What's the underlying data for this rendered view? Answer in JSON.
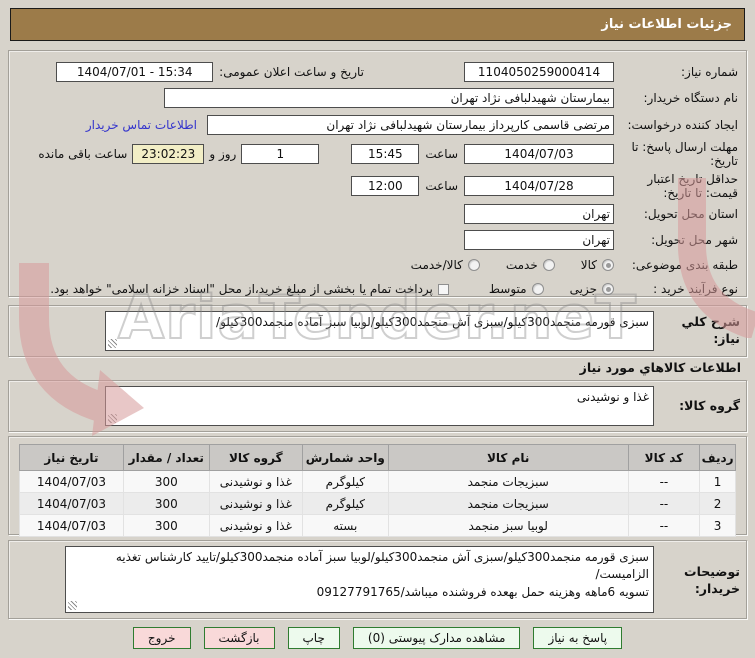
{
  "title_bar": {
    "text": "جزئیات اطلاعات نیاز"
  },
  "form": {
    "need_number": {
      "label": "شماره نیاز:",
      "value": "1104050259000414"
    },
    "announce_datetime": {
      "label": "تاریخ و ساعت اعلان عمومی:",
      "value": "1404/07/01 - 15:34"
    },
    "buyer_org": {
      "label": "نام دستگاه خریدار:",
      "value": "بیمارستان شهیدلبافی نژاد تهران"
    },
    "request_creator": {
      "label": "ایجاد کننده درخواست:",
      "value": "مرتضی  قاسمی کارپرداز بیمارستان شهیدلبافی نژاد تهران"
    },
    "buyer_contact_link": "اطلاعات تماس خریدار",
    "response_deadline": {
      "label": "مهلت ارسال پاسخ: تا تاریخ:",
      "date": "1404/07/03",
      "hour_label": "ساعت",
      "time": "15:45"
    },
    "remaining": {
      "days": "1",
      "days_label": "روز و",
      "time": "23:02:23",
      "suffix": "ساعت باقی مانده"
    },
    "price_validity": {
      "label": "حداقل تاریخ اعتبار قیمت: تا تاریخ:",
      "date": "1404/07/28",
      "hour_label": "ساعت",
      "time": "12:00"
    },
    "delivery_province": {
      "label": "استان محل تحویل:",
      "value": "تهران"
    },
    "delivery_city": {
      "label": "شهر محل تحویل:",
      "value": "تهران"
    },
    "subject_class": {
      "label": "طبقه بندی موضوعی:",
      "options": [
        "کالا",
        "خدمت",
        "کالا/خدمت"
      ],
      "selected": 0
    },
    "purchase_type": {
      "label": "نوع فرآیند خرید :",
      "options": [
        "جزیی",
        "متوسط"
      ],
      "selected": 0,
      "checkbox_label": "پرداخت تمام یا بخشی از مبلغ خرید،از محل \"اسناد خزانه اسلامی\" خواهد بود.",
      "checkbox_checked": false
    }
  },
  "need_description": {
    "label": "شرح کلي نیاز:",
    "value": "سبزی قورمه منجمد300کیلو/سبزی آش منجمد300کیلو/لوبیا سبز آماده منجمد300کیلو/"
  },
  "goods_section": {
    "header": "اطلاعات کالاهاي مورد نیاز",
    "group": {
      "label": "گروه کالا:",
      "value": "غذا و نوشیدنی"
    },
    "table": {
      "headers": [
        "ردیف",
        "کد کالا",
        "نام کالا",
        "واحد شمارش",
        "گروه کالا",
        "تعداد / مقدار",
        "تاریخ نیاز"
      ],
      "rows": [
        [
          "1",
          "--",
          "سبزیجات منجمد",
          "کیلوگرم",
          "غذا و نوشیدنی",
          "300",
          "1404/07/03"
        ],
        [
          "2",
          "--",
          "سبزیجات منجمد",
          "کیلوگرم",
          "غذا و نوشیدنی",
          "300",
          "1404/07/03"
        ],
        [
          "3",
          "--",
          "لوبیا سبز منجمد",
          "بسته",
          "غذا و نوشیدنی",
          "300",
          "1404/07/03"
        ]
      ]
    }
  },
  "buyer_notes": {
    "label": "توضیحات خریدار:",
    "value": "سبزی قورمه منجمد300کیلو/سبزی آش منجمد300کیلو/لوبیا سبز آماده منجمد300کیلو/تایید کارشناس تغذیه الزامیست/\nتسویه 6ماهه وهزینه حمل بهعده فروشنده میباشد/09127791765"
  },
  "buttons": [
    {
      "label": "پاسخ به نیاز",
      "type": "green"
    },
    {
      "label": "مشاهده مدارک پیوستی (0)",
      "type": "green"
    },
    {
      "label": "چاپ",
      "type": "green"
    },
    {
      "label": "بازگشت",
      "type": "pink"
    },
    {
      "label": "خروج",
      "type": "pink"
    }
  ],
  "watermark": {
    "text": "AriaTender.neT"
  },
  "colors": {
    "title_bg": "#9c7b49",
    "page_bg": "#d7d3cb",
    "button_green": "#edfaed",
    "button_pink": "#f9d9d9",
    "button_border": "#2f7c30",
    "remaining_bg": "#f2eec6",
    "link": "#3434cc"
  }
}
